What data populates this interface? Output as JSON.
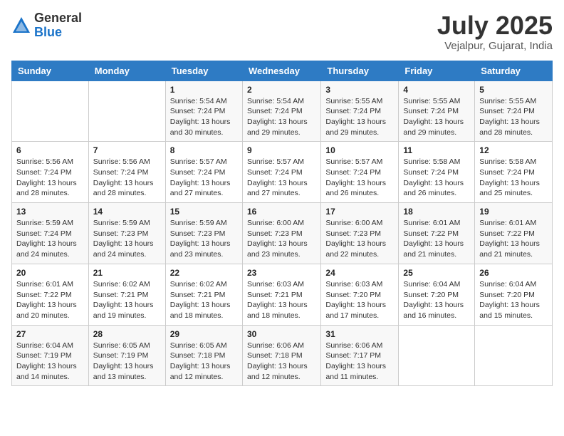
{
  "logo": {
    "general": "General",
    "blue": "Blue"
  },
  "title": "July 2025",
  "location": "Vejalpur, Gujarat, India",
  "days_of_week": [
    "Sunday",
    "Monday",
    "Tuesday",
    "Wednesday",
    "Thursday",
    "Friday",
    "Saturday"
  ],
  "weeks": [
    [
      {
        "num": "",
        "sunrise": "",
        "sunset": "",
        "daylight": ""
      },
      {
        "num": "",
        "sunrise": "",
        "sunset": "",
        "daylight": ""
      },
      {
        "num": "1",
        "sunrise": "Sunrise: 5:54 AM",
        "sunset": "Sunset: 7:24 PM",
        "daylight": "Daylight: 13 hours and 30 minutes."
      },
      {
        "num": "2",
        "sunrise": "Sunrise: 5:54 AM",
        "sunset": "Sunset: 7:24 PM",
        "daylight": "Daylight: 13 hours and 29 minutes."
      },
      {
        "num": "3",
        "sunrise": "Sunrise: 5:55 AM",
        "sunset": "Sunset: 7:24 PM",
        "daylight": "Daylight: 13 hours and 29 minutes."
      },
      {
        "num": "4",
        "sunrise": "Sunrise: 5:55 AM",
        "sunset": "Sunset: 7:24 PM",
        "daylight": "Daylight: 13 hours and 29 minutes."
      },
      {
        "num": "5",
        "sunrise": "Sunrise: 5:55 AM",
        "sunset": "Sunset: 7:24 PM",
        "daylight": "Daylight: 13 hours and 28 minutes."
      }
    ],
    [
      {
        "num": "6",
        "sunrise": "Sunrise: 5:56 AM",
        "sunset": "Sunset: 7:24 PM",
        "daylight": "Daylight: 13 hours and 28 minutes."
      },
      {
        "num": "7",
        "sunrise": "Sunrise: 5:56 AM",
        "sunset": "Sunset: 7:24 PM",
        "daylight": "Daylight: 13 hours and 28 minutes."
      },
      {
        "num": "8",
        "sunrise": "Sunrise: 5:57 AM",
        "sunset": "Sunset: 7:24 PM",
        "daylight": "Daylight: 13 hours and 27 minutes."
      },
      {
        "num": "9",
        "sunrise": "Sunrise: 5:57 AM",
        "sunset": "Sunset: 7:24 PM",
        "daylight": "Daylight: 13 hours and 27 minutes."
      },
      {
        "num": "10",
        "sunrise": "Sunrise: 5:57 AM",
        "sunset": "Sunset: 7:24 PM",
        "daylight": "Daylight: 13 hours and 26 minutes."
      },
      {
        "num": "11",
        "sunrise": "Sunrise: 5:58 AM",
        "sunset": "Sunset: 7:24 PM",
        "daylight": "Daylight: 13 hours and 26 minutes."
      },
      {
        "num": "12",
        "sunrise": "Sunrise: 5:58 AM",
        "sunset": "Sunset: 7:24 PM",
        "daylight": "Daylight: 13 hours and 25 minutes."
      }
    ],
    [
      {
        "num": "13",
        "sunrise": "Sunrise: 5:59 AM",
        "sunset": "Sunset: 7:24 PM",
        "daylight": "Daylight: 13 hours and 24 minutes."
      },
      {
        "num": "14",
        "sunrise": "Sunrise: 5:59 AM",
        "sunset": "Sunset: 7:23 PM",
        "daylight": "Daylight: 13 hours and 24 minutes."
      },
      {
        "num": "15",
        "sunrise": "Sunrise: 5:59 AM",
        "sunset": "Sunset: 7:23 PM",
        "daylight": "Daylight: 13 hours and 23 minutes."
      },
      {
        "num": "16",
        "sunrise": "Sunrise: 6:00 AM",
        "sunset": "Sunset: 7:23 PM",
        "daylight": "Daylight: 13 hours and 23 minutes."
      },
      {
        "num": "17",
        "sunrise": "Sunrise: 6:00 AM",
        "sunset": "Sunset: 7:23 PM",
        "daylight": "Daylight: 13 hours and 22 minutes."
      },
      {
        "num": "18",
        "sunrise": "Sunrise: 6:01 AM",
        "sunset": "Sunset: 7:22 PM",
        "daylight": "Daylight: 13 hours and 21 minutes."
      },
      {
        "num": "19",
        "sunrise": "Sunrise: 6:01 AM",
        "sunset": "Sunset: 7:22 PM",
        "daylight": "Daylight: 13 hours and 21 minutes."
      }
    ],
    [
      {
        "num": "20",
        "sunrise": "Sunrise: 6:01 AM",
        "sunset": "Sunset: 7:22 PM",
        "daylight": "Daylight: 13 hours and 20 minutes."
      },
      {
        "num": "21",
        "sunrise": "Sunrise: 6:02 AM",
        "sunset": "Sunset: 7:21 PM",
        "daylight": "Daylight: 13 hours and 19 minutes."
      },
      {
        "num": "22",
        "sunrise": "Sunrise: 6:02 AM",
        "sunset": "Sunset: 7:21 PM",
        "daylight": "Daylight: 13 hours and 18 minutes."
      },
      {
        "num": "23",
        "sunrise": "Sunrise: 6:03 AM",
        "sunset": "Sunset: 7:21 PM",
        "daylight": "Daylight: 13 hours and 18 minutes."
      },
      {
        "num": "24",
        "sunrise": "Sunrise: 6:03 AM",
        "sunset": "Sunset: 7:20 PM",
        "daylight": "Daylight: 13 hours and 17 minutes."
      },
      {
        "num": "25",
        "sunrise": "Sunrise: 6:04 AM",
        "sunset": "Sunset: 7:20 PM",
        "daylight": "Daylight: 13 hours and 16 minutes."
      },
      {
        "num": "26",
        "sunrise": "Sunrise: 6:04 AM",
        "sunset": "Sunset: 7:20 PM",
        "daylight": "Daylight: 13 hours and 15 minutes."
      }
    ],
    [
      {
        "num": "27",
        "sunrise": "Sunrise: 6:04 AM",
        "sunset": "Sunset: 7:19 PM",
        "daylight": "Daylight: 13 hours and 14 minutes."
      },
      {
        "num": "28",
        "sunrise": "Sunrise: 6:05 AM",
        "sunset": "Sunset: 7:19 PM",
        "daylight": "Daylight: 13 hours and 13 minutes."
      },
      {
        "num": "29",
        "sunrise": "Sunrise: 6:05 AM",
        "sunset": "Sunset: 7:18 PM",
        "daylight": "Daylight: 13 hours and 12 minutes."
      },
      {
        "num": "30",
        "sunrise": "Sunrise: 6:06 AM",
        "sunset": "Sunset: 7:18 PM",
        "daylight": "Daylight: 13 hours and 12 minutes."
      },
      {
        "num": "31",
        "sunrise": "Sunrise: 6:06 AM",
        "sunset": "Sunset: 7:17 PM",
        "daylight": "Daylight: 13 hours and 11 minutes."
      },
      {
        "num": "",
        "sunrise": "",
        "sunset": "",
        "daylight": ""
      },
      {
        "num": "",
        "sunrise": "",
        "sunset": "",
        "daylight": ""
      }
    ]
  ]
}
